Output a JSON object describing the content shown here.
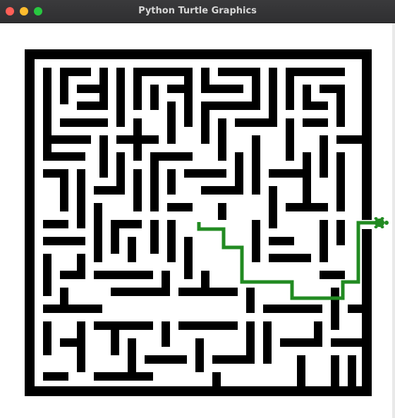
{
  "window": {
    "title": "Python Turtle Graphics",
    "buttons": [
      "close",
      "minimize",
      "zoom"
    ]
  },
  "canvas": {
    "background": "#ffffff",
    "maze_color": "#000000",
    "path_color": "#228b22",
    "turtle_icon": "turtle-icon"
  }
}
